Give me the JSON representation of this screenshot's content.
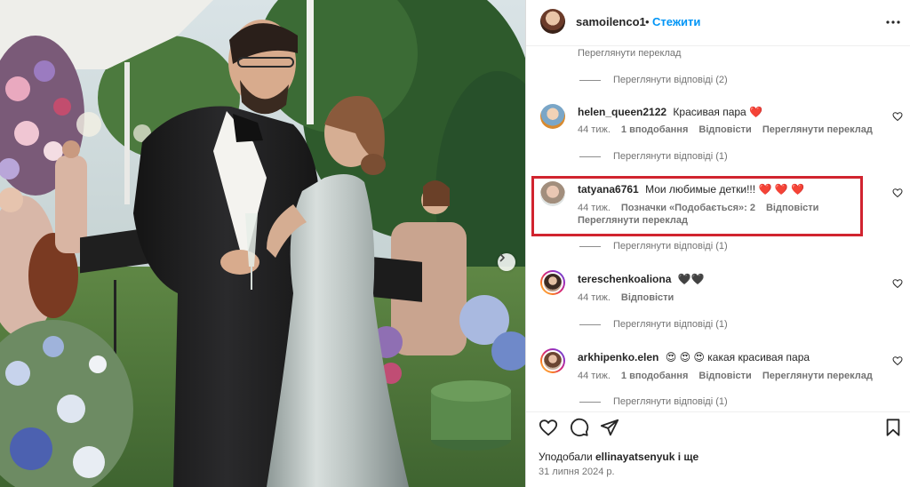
{
  "header": {
    "username": "samoilenco1",
    "separator": "•",
    "follow_label": "Стежити"
  },
  "top_partial": {
    "see_translation": "Переглянути переклад",
    "view_replies": "Переглянути відповіді (2)"
  },
  "comments": [
    {
      "username": "helen_queen2122",
      "text": "Красивая пара",
      "emoji": "❤️",
      "time": "44 тиж.",
      "likes": "1 вподобання",
      "reply": "Відповісти",
      "see_translation": "Переглянути переклад",
      "view_replies": "Переглянути відповіді (1)"
    },
    {
      "username": "tatyana6761",
      "text": "Мои любимые детки!!!",
      "emoji": "❤️ ❤️ ❤️",
      "time": "44 тиж.",
      "likes": "Позначки «Подобається»: 2",
      "reply": "Відповісти",
      "see_translation": "Переглянути переклад",
      "view_replies": "Переглянути відповіді (1)"
    },
    {
      "username": "tereschenkoaliona",
      "text": "",
      "emoji": "🖤🖤",
      "time": "44 тиж.",
      "reply": "Відповісти",
      "view_replies": "Переглянути відповіді (1)"
    },
    {
      "username": "arkhipenko.elen",
      "text": "какая красивая пара",
      "emoji": "😍 😍 😍",
      "time": "44 тиж.",
      "likes": "1 вподобання",
      "reply": "Відповісти",
      "see_translation": "Переглянути переклад",
      "view_replies": "Переглянути відповіді (1)"
    }
  ],
  "footer": {
    "liked_prefix": "Уподобали",
    "liked_user": "ellinayatsenyuk",
    "liked_suffix": "і ще",
    "date": "31 липня 2024 р."
  },
  "icons": {
    "heart": "heart-icon",
    "comment": "comment-icon",
    "share": "share-icon",
    "save": "bookmark-icon",
    "more": "more-icon",
    "next": "chevron-right-icon"
  },
  "colors": {
    "accent": "#0095f6",
    "highlight": "#d1242f",
    "heart_red": "#ed4956",
    "muted": "#737373"
  }
}
